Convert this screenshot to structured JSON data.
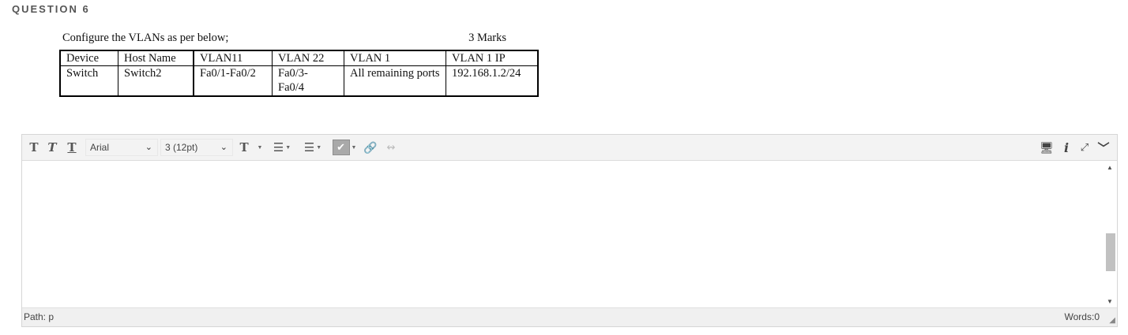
{
  "question": {
    "title": "QUESTION 6"
  },
  "prompt": {
    "text": "Configure the VLANs as per below;",
    "marks": "3 Marks"
  },
  "table": {
    "headers": [
      "Device",
      "Host Name",
      "VLAN11",
      "VLAN 22",
      "VLAN 1",
      "VLAN 1 IP"
    ],
    "rows": [
      [
        "Switch",
        "Switch2",
        "Fa0/1-Fa0/2",
        "Fa0/3-\nFa0/4",
        "All remaining ports",
        "192.168.1.2/24"
      ]
    ]
  },
  "editor": {
    "toolbar": {
      "bold_glyph": "T",
      "italic_glyph": "T",
      "underline_glyph": "T",
      "font_family": "Arial",
      "font_size": "3 (12pt)",
      "text_color_glyph": "T",
      "spellcheck_glyph": "ABC"
    },
    "status": {
      "path_label": "Path:",
      "path_value": "p",
      "words_label": "Words:",
      "words_value": "0"
    }
  }
}
